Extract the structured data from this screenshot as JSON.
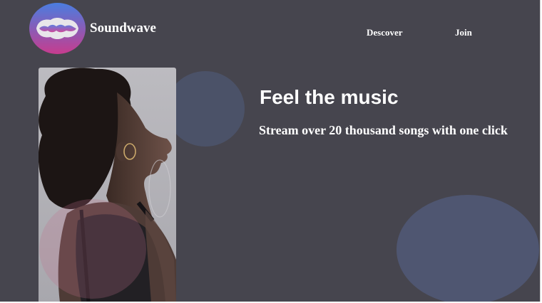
{
  "header": {
    "brand": "Soundwave",
    "nav": {
      "discover": "Descover",
      "join": "Join"
    }
  },
  "hero": {
    "headline": "Feel the music",
    "subheadline": "Stream over 20 thousand songs with one click"
  },
  "colors": {
    "background": "#46454e",
    "text": "#ffffff",
    "logo_gradient_top": "#4a7de0",
    "logo_gradient_bottom": "#c73c8e"
  },
  "icons": {
    "logo": "soundwave-logo-icon",
    "photo": "woman-listening-photo"
  }
}
